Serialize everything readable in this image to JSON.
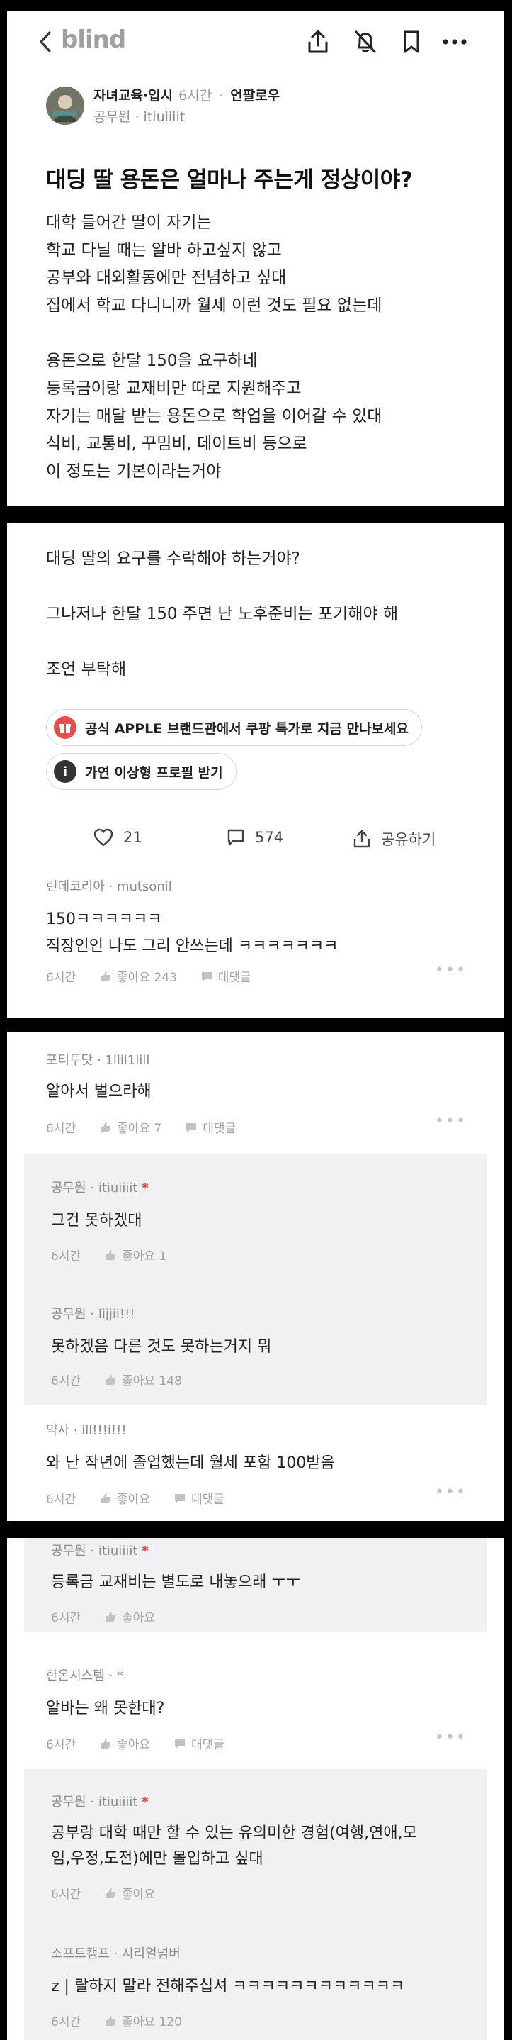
{
  "app": {
    "logo": "blind"
  },
  "post": {
    "author_company": "자녀교육·입시",
    "time": "6시간",
    "follow_label": "언팔로우",
    "author_sub": "공무원 · itiuiiiit",
    "title": "대딩 딸 용돈은 얼마나 주는게 정상이야?",
    "body": [
      "대학 들어간 딸이 자기는",
      "학교 다닐 때는 알바 하고싶지 않고",
      "공부와 대외활동에만 전념하고 싶대",
      "집에서 학교 다니니까 월세 이런 것도 필요 없는데",
      "",
      "용돈으로 한달 150을 요구하네",
      "등록금이랑 교재비만 따로 지원해주고",
      "자기는 매달 받는 용돈으로 학업을 이어갈 수 있대",
      "식비, 교통비, 꾸밈비, 데이트비 등으로",
      "이 정도는 기본이라는거야"
    ],
    "body2": [
      "대딩 딸의 요구를 수락해야 하는거야?",
      "",
      "그나저나 한달 150 주면 난 노후준비는 포기해야 해",
      "",
      "조언 부탁해"
    ],
    "ads": [
      {
        "label": "공식 APPLE 브랜드관에서 쿠팡 특가로 지금 만나보세요",
        "icon": "gift-icon",
        "color": "#e84c4c"
      },
      {
        "label": "가연 이상형 프로필 받기",
        "icon": "info-icon",
        "color": "#333333"
      }
    ],
    "likes": "21",
    "comments": "574",
    "share_label": "공유하기"
  },
  "labels": {
    "like": "좋아요",
    "reply": "대댓글",
    "op_mark": "*"
  },
  "comments": [
    {
      "author": "린데코리아 · mutsonil",
      "lines": [
        "150ㅋㅋㅋㅋㅋㅋ",
        "직장인인 나도 그리 안쓰는데 ㅋㅋㅋㅋㅋㅋㅋ"
      ],
      "time": "6시간",
      "likes": "좋아요 243"
    },
    {
      "author": "포티투닷 · 1llil1lill",
      "lines": [
        "알아서 벌으라해"
      ],
      "time": "6시간",
      "likes": "좋아요 7"
    },
    {
      "author": "공무원 · itiuiiiit",
      "lines": [
        "그건 못하겠대"
      ],
      "time": "6시간",
      "likes": "좋아요 1",
      "op": true
    },
    {
      "author": "공무원 · lijjii!!!",
      "lines": [
        "못하겠음 다른 것도 못하는거지 뭐"
      ],
      "time": "6시간",
      "likes": "좋아요 148"
    },
    {
      "author": "약사 · ill!!!i!!!",
      "lines": [
        "와 난 작년에 졸업했는데 월세 포함 100받음"
      ],
      "time": "6시간",
      "likes": "좋아요"
    },
    {
      "author": "공무원 · itiuiiiit",
      "lines": [
        "등록금 교재비는 별도로 내놓으래 ㅜㅜ"
      ],
      "time": "6시간",
      "likes": "좋아요",
      "op": true
    },
    {
      "author": "한온시스템 · *",
      "lines": [
        "알바는 왜 못한대?"
      ],
      "time": "6시간",
      "likes": "좋아요"
    },
    {
      "author": "공무원 · itiuiiiit",
      "lines": [
        "공부랑 대학 때만 할 수 있는 유의미한 경험(여행,연애,모",
        "임,우정,도전)에만 몰입하고 싶대"
      ],
      "time": "6시간",
      "likes": "좋아요",
      "op": true
    },
    {
      "author": "소프트캠프 · 시리얼넘버",
      "lines": [
        "z | 랄하지 말라 전해주십셔 ㅋㅋㅋㅋㅋㅋㅋㅋㅋㅋㅋㅋ"
      ],
      "time": "6시간",
      "likes": "좋아요 120"
    }
  ]
}
